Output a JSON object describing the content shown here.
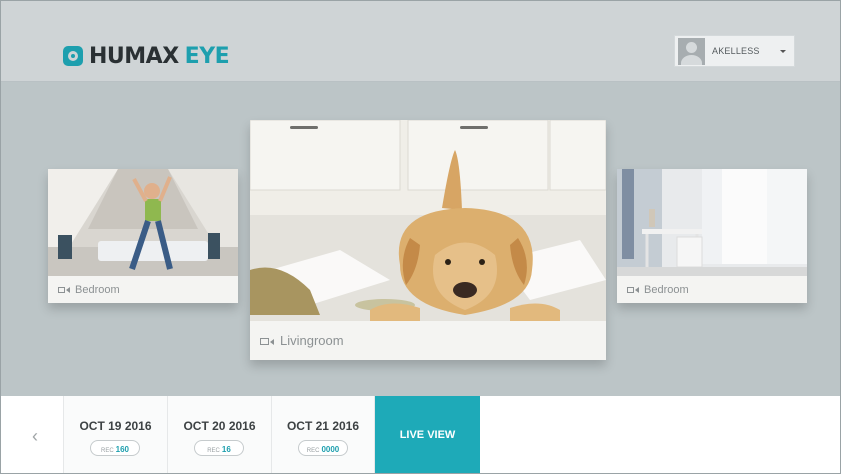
{
  "app": {
    "brand_name": "HUMAX",
    "brand_product": "EYE",
    "accent_color": "#1d9fae"
  },
  "user": {
    "name": "AKELLESS",
    "avatar_icon": "user-avatar-placeholder"
  },
  "cameras": [
    {
      "label": "Bedroom",
      "icon": "video-camera-icon"
    },
    {
      "label": "Livingroom",
      "icon": "video-camera-icon"
    },
    {
      "label": "Bedroom",
      "icon": "video-camera-icon"
    }
  ],
  "timeline": {
    "prev_icon": "chevron-left-icon",
    "prev_glyph": "‹",
    "dates": [
      {
        "date": "OCT 19 2016",
        "rec_label": "REC",
        "rec_count": "160"
      },
      {
        "date": "OCT 20 2016",
        "rec_label": "REC",
        "rec_count": "16"
      },
      {
        "date": "OCT 21 2016",
        "rec_label": "REC",
        "rec_count": "0000"
      }
    ],
    "live_view_label": "LIVE VIEW"
  }
}
